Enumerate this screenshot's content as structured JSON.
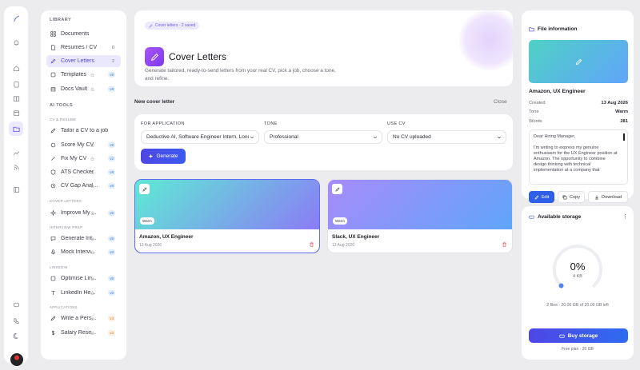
{
  "hero": {
    "pill": "Cover letters · 2 saved",
    "title": "Cover Letters",
    "desc_line1": "Generate tailored, ready-to-send letters from your real CV, pick a job, choose a tone,",
    "desc_line2": "and refine."
  },
  "sidebar": {
    "library_label": "LIBRARY",
    "library": [
      {
        "label": "Documents",
        "icon": "grid-icon",
        "count": ""
      },
      {
        "label": "Résumés / CV",
        "icon": "file-icon",
        "count": "0"
      },
      {
        "label": "Cover Letters",
        "icon": "pen-icon",
        "count": "2"
      },
      {
        "label": "Templates",
        "icon": "template-icon",
        "badge": "v8"
      },
      {
        "label": "Docs Vault",
        "icon": "vault-icon",
        "badge": "v8"
      }
    ],
    "ai_label": "AI TOOLS",
    "cv_label": "CV & RESUME",
    "cv_tools": [
      {
        "label": "Tailor a CV to a job",
        "icon": "edit-icon"
      },
      {
        "label": "Score My CV",
        "icon": "score-icon",
        "badge": "v8"
      },
      {
        "label": "Fix My CV",
        "icon": "fix-icon",
        "badge": "v2"
      },
      {
        "label": "ATS Checker",
        "icon": "ats-icon",
        "badge": "v8"
      },
      {
        "label": "CV Gap Anal...",
        "icon": "gap-icon",
        "badge": "v8"
      }
    ],
    "cl_label": "COVER LETTERS",
    "cl_tools": [
      {
        "label": "Improve My ...",
        "icon": "sparkle-icon",
        "badge": "v8"
      }
    ],
    "ip_label": "INTERVIEW PREP",
    "ip_tools": [
      {
        "label": "Generate Int...",
        "icon": "chat-icon",
        "badge": "v8"
      },
      {
        "label": "Mock Intervi...",
        "icon": "mic-icon",
        "badge": "v8"
      }
    ],
    "li_label": "LINKEDIN",
    "li_tools": [
      {
        "label": "Optimise Lin...",
        "icon": "linkedin-icon",
        "badge": "v8"
      },
      {
        "label": "LinkedIn He...",
        "icon": "text-icon",
        "badge": "v8"
      }
    ],
    "app_label": "APPLICATIONS",
    "app_tools": [
      {
        "label": "Write a Pers...",
        "icon": "write-icon",
        "badge": "v3"
      },
      {
        "label": "Salary Rese...",
        "icon": "dollar-icon",
        "badge": "v3"
      }
    ]
  },
  "form": {
    "section_title": "New cover letter",
    "close": "Close",
    "app_label": "FOR APPLICATION",
    "app_value": "Deductive AI, Software Engineer Intern, London",
    "tone_label": "TONE",
    "tone_value": "Professional",
    "cv_label": "USE CV",
    "cv_value": "No CV uploaded",
    "generate": "Generate"
  },
  "cards": [
    {
      "tone": "Warm",
      "name": "Amazon, UX Engineer",
      "date": "13 Aug 2026",
      "gradient": "linear-gradient(135deg,#5eead4,#8b7cf6)"
    },
    {
      "tone": "Warm",
      "name": "Slack, UX Engineer",
      "date": "13 Aug 2026",
      "gradient": "linear-gradient(135deg,#a78bfa,#60a5fa)"
    }
  ],
  "info": {
    "header": "File information",
    "title": "Amazon, UX Engineer",
    "created_label": "Created",
    "created": "13 Aug 2026",
    "tone_label": "Tone",
    "tone": "Warm",
    "words_label": "Words",
    "words": "281",
    "letter_p1": "Dear Hiring Manager,",
    "letter_p2": "I'm writing to express my genuine enthusiasm for the UX Engineer position at Amazon. The opportunity to combine design thinking with technical implementation at a company that",
    "edit": "Edit",
    "copy": "Copy",
    "download": "Download"
  },
  "storage": {
    "header": "Available storage",
    "pct": "0%",
    "kb": "4 KB",
    "meta": "2 files · 20.00 GB of 20.00 GB left",
    "buy": "Buy storage",
    "plan": "Free plan · 20 GB",
    "used_fraction": 0
  }
}
